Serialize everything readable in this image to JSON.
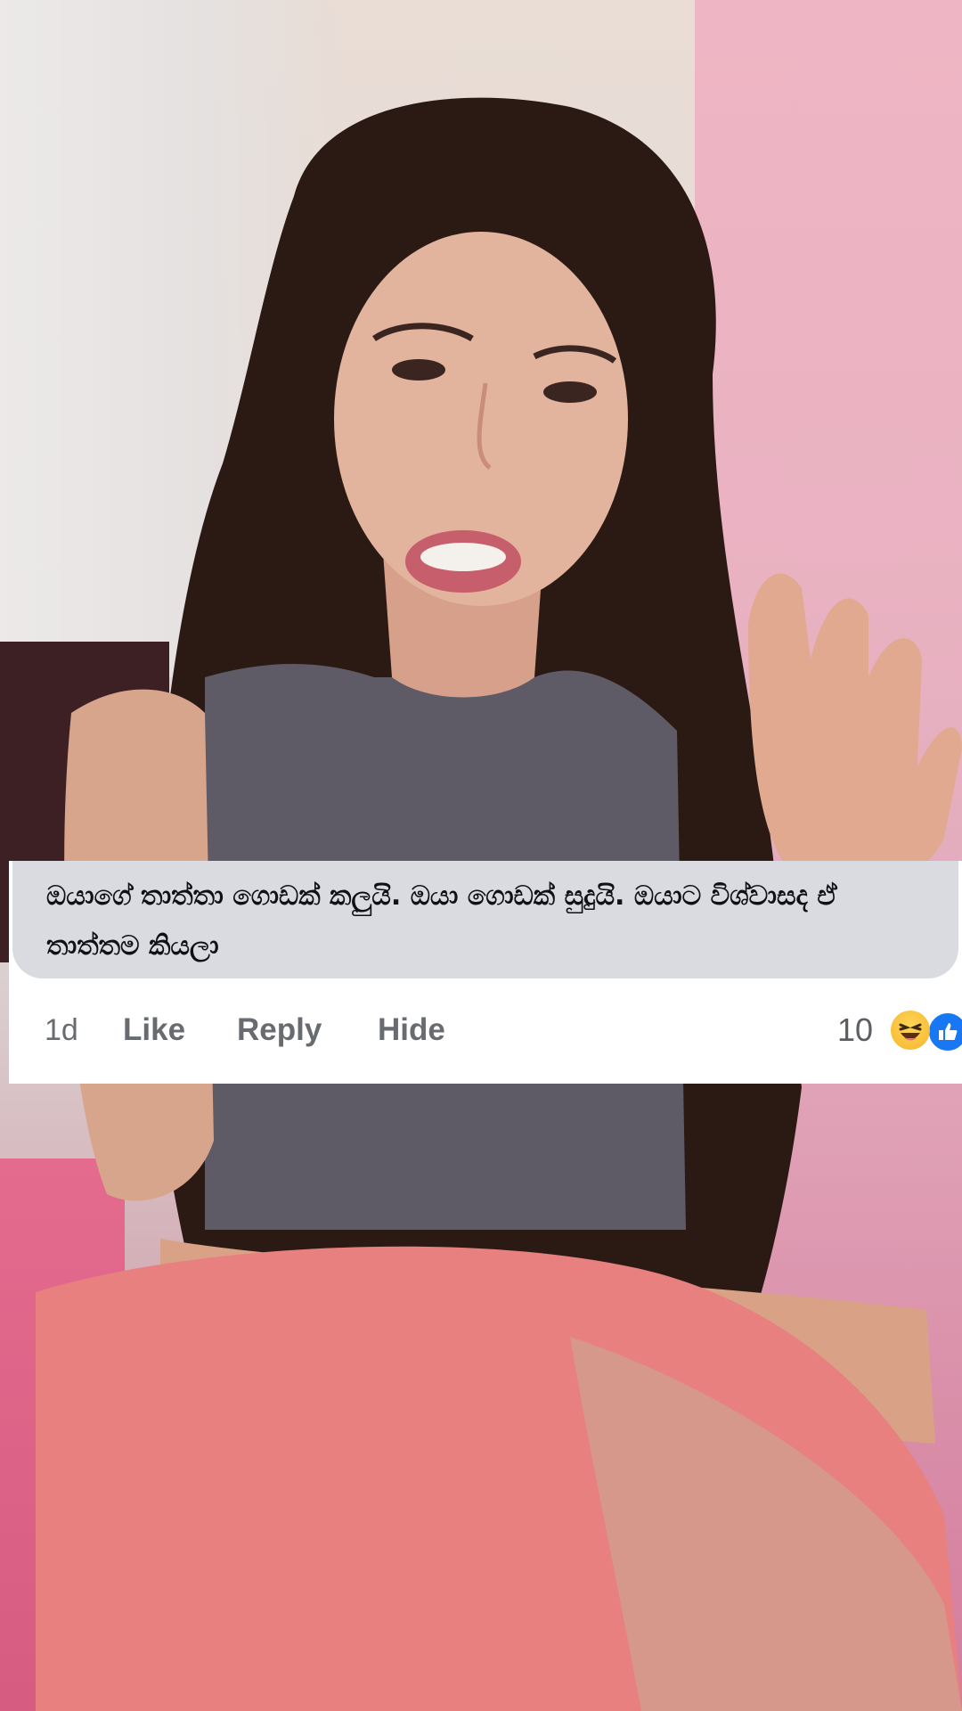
{
  "comment": {
    "text_line1": "ඔයාගේ තාත්තා ගොඩක් කලුයි. ඔයා ගොඩක් සුදුයි. ඔයාට විශ්වාසද ඒ",
    "text_line2": "තාත්තම කියලා",
    "time": "1d",
    "like_label": "Like",
    "reply_label": "Reply",
    "hide_label": "Hide",
    "reaction_count": "10",
    "reactions": [
      "haha-icon",
      "like-icon"
    ]
  },
  "colors": {
    "bubble": "#dadbe0",
    "action_text": "#686b70",
    "like_blue": "#1877f2",
    "haha_yellow": "#f5b52a"
  }
}
